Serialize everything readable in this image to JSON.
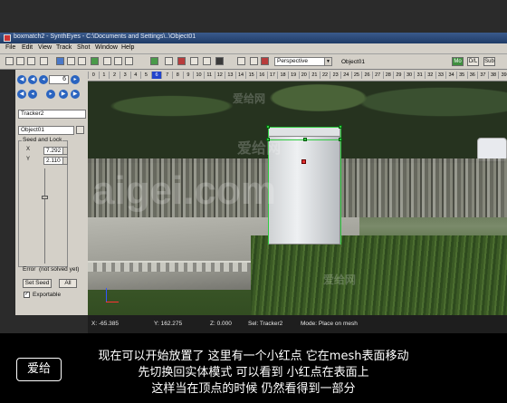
{
  "window": {
    "title": "boxmatch2 - SynthEyes - C:\\Documents and Settings\\..\\Object01"
  },
  "menu": [
    "File",
    "Edit",
    "View",
    "Track",
    "Shot",
    "Window",
    "Help"
  ],
  "toolbar": {
    "view_select": "Perspective",
    "object_label": "Object01",
    "mode_buttons": [
      "Mo",
      "D/L",
      "Sub"
    ]
  },
  "ruler": {
    "ticks": [
      "0",
      "1",
      "2",
      "3",
      "4",
      "5",
      "6",
      "7",
      "8",
      "9",
      "10",
      "11",
      "12",
      "13",
      "14",
      "15",
      "16",
      "17",
      "18",
      "19",
      "20",
      "21",
      "22",
      "23",
      "24",
      "25",
      "26",
      "27",
      "28",
      "29",
      "30",
      "31",
      "32",
      "33",
      "34",
      "35",
      "36",
      "37",
      "38",
      "39"
    ],
    "current_frame_index": 6
  },
  "left_panel": {
    "frame_value": "6",
    "tracker_name": "Tracker2",
    "object_select": "Object01",
    "seed_group_title": "Seed and Lock",
    "x_label": "X",
    "y_label": "Y",
    "x_value": "7.292",
    "y_value": "2.110",
    "error_label": "Error",
    "error_value": "(not solved yet)",
    "set_seed_button": "Set Seed",
    "all_button": "All",
    "exportable_label": "Exportable"
  },
  "status": {
    "x": "X:  -65.385",
    "y": "Y:  162.275",
    "z": "Z:  0.000",
    "sel": "Sel: Tracker2",
    "mode": "Mode: Place on mesh"
  },
  "subtitles": [
    "现在可以开始放置了  这里有一个小红点  它在mesh表面移动",
    "先切换回实体模式  可以看到  小红点在表面上",
    "这样当在顶点的时候  仍然看得到一部分"
  ],
  "watermark": {
    "logo": "爱给",
    "site": "aigei.com",
    "brand": "爱给网"
  }
}
